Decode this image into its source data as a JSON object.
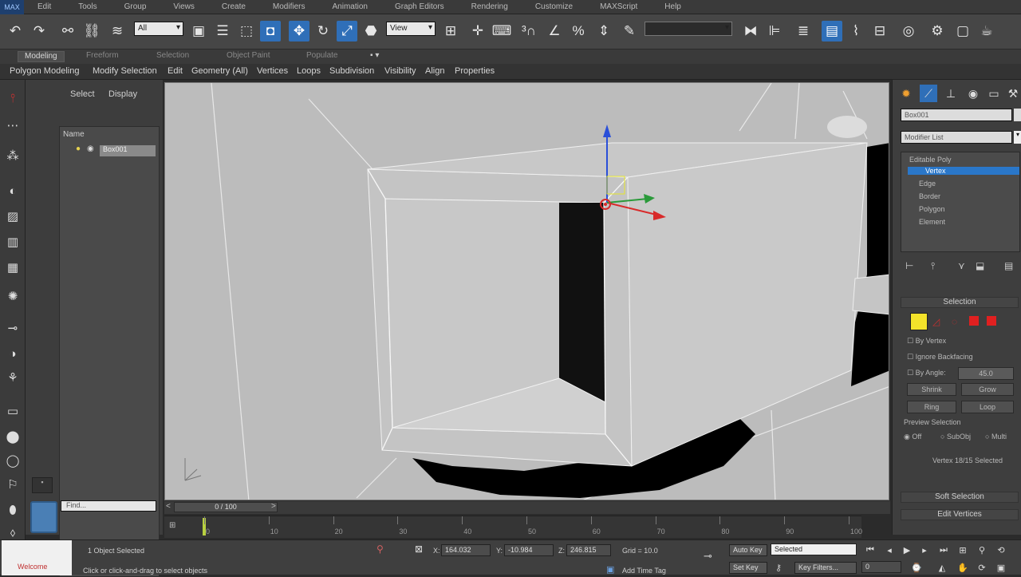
{
  "app": {
    "logo": "MAX"
  },
  "menubar": {
    "items": [
      "Edit",
      "Tools",
      "Group",
      "Views",
      "Create",
      "Modifiers",
      "Animation",
      "Graph Editors",
      "Rendering",
      "Customize",
      "MAXScript",
      "Help"
    ]
  },
  "toolbar": {
    "selection_filter": "All",
    "ref_coord": "View",
    "named_selection": ""
  },
  "ribbon": {
    "tabs": [
      "Modeling",
      "Freeform",
      "Selection",
      "Object Paint",
      "Populate"
    ],
    "active_tab": "Modeling",
    "sub_items": [
      "Polygon Modeling",
      "Modify Selection",
      "Edit",
      "Geometry (All)",
      "Vertices",
      "Loops",
      "Subdivision",
      "Visibility",
      "Align",
      "Properties"
    ]
  },
  "explorer": {
    "tabs": [
      "Select",
      "Display"
    ],
    "column_header": "Name",
    "objects": [
      {
        "name": "Box001"
      }
    ],
    "filter_placeholder": "Find..."
  },
  "command_panel": {
    "object_name": "Box001",
    "modifier_list_label": "Modifier List",
    "stack": {
      "base": "Editable Poly",
      "levels": [
        "Vertex",
        "Edge",
        "Border",
        "Polygon",
        "Element"
      ],
      "selected_level": "Vertex"
    },
    "selection_rollout": {
      "title": "Selection",
      "by_vertex": "By Vertex",
      "ignore_backfacing": "Ignore Backfacing",
      "by_angle": "By Angle:",
      "angle_value": "45.0",
      "shrink": "Shrink",
      "grow": "Grow",
      "ring": "Ring",
      "loop": "Loop",
      "preview_label": "Preview Selection",
      "preview_options": [
        "Off",
        "SubObj",
        "Multi"
      ],
      "preview_selected": "Off",
      "status": "Vertex 18/15 Selected"
    },
    "soft_selection": "Soft Selection",
    "edit_vertices": "Edit Vertices"
  },
  "timeline": {
    "slider_text": "0 / 100",
    "ticks": [
      "0",
      "10",
      "20",
      "30",
      "40",
      "50",
      "60",
      "70",
      "80",
      "90",
      "100"
    ]
  },
  "status": {
    "maxscript_text": "Welcome",
    "selection_count": "1 Object Selected",
    "prompt": "Click or click-and-drag to select objects",
    "x_label": "X:",
    "x_value": "164.032",
    "y_label": "Y:",
    "y_value": "-10.984",
    "z_label": "Z:",
    "z_value": "246.815",
    "grid": "Grid = 10.0",
    "add_time_tag": "Add Time Tag",
    "auto_key": "Auto Key",
    "set_key": "Set Key",
    "key_mode": "Selected",
    "key_filters": "Key Filters...",
    "frame": "0"
  }
}
